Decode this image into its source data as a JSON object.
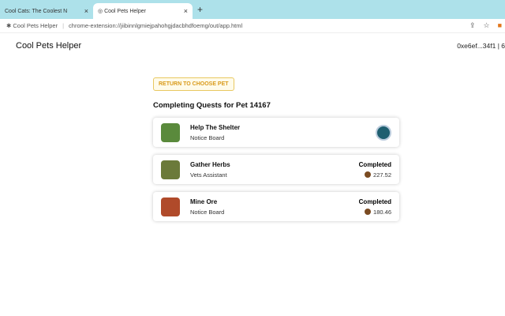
{
  "browser": {
    "tabs": [
      {
        "title": "Cool Cats: The Coolest N"
      },
      {
        "title": "Cool Pets Helper"
      }
    ],
    "new_tab": "+",
    "close": "×",
    "site_name": "Cool Pets Helper",
    "url": "chrome-extension://jiibinnlgmiejpahohgjdacbhdfoemg/out/app.html"
  },
  "app": {
    "title": "Cool Pets Helper",
    "wallet": "0xe6ef...34f1 | 6"
  },
  "main": {
    "return_button": "RETURN TO CHOOSE PET",
    "heading": "Completing Quests for Pet 14167",
    "quests": [
      {
        "name": "Help The Shelter",
        "source": "Notice Board",
        "status": "",
        "reward": "",
        "icon": "shelter-icon",
        "color": "#5a8a3c"
      },
      {
        "name": "Gather Herbs",
        "source": "Vets Assistant",
        "status": "Completed",
        "reward": "227.52",
        "icon": "herbs-icon",
        "color": "#6b7a3a"
      },
      {
        "name": "Mine Ore",
        "source": "Notice Board",
        "status": "Completed",
        "reward": "180.46",
        "icon": "ore-icon",
        "color": "#b04a2a"
      }
    ]
  }
}
